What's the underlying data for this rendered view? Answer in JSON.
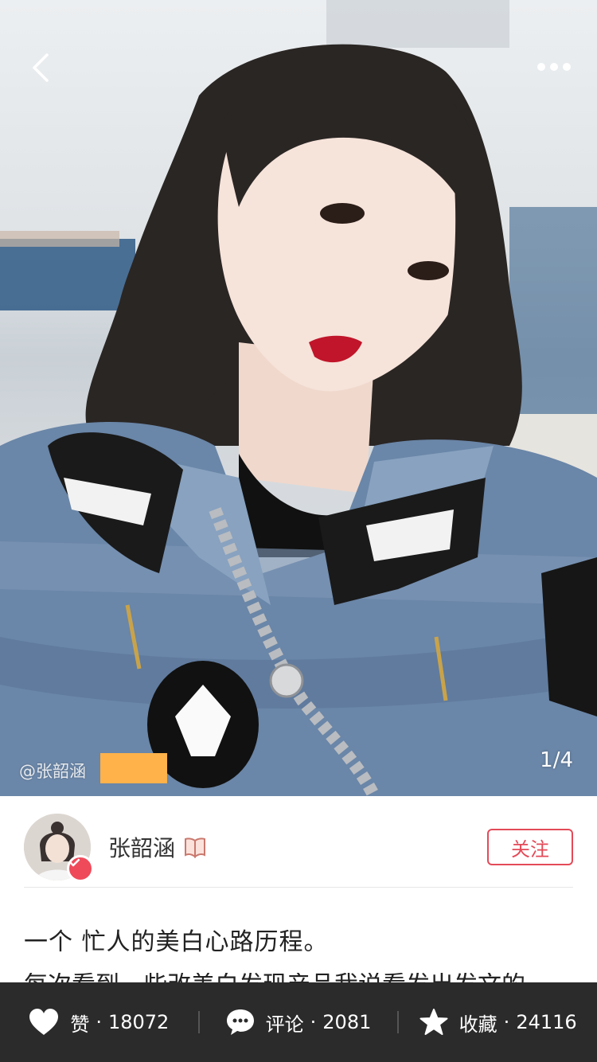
{
  "photo": {
    "watermark": "@张韶涵",
    "counter": "1/4"
  },
  "nav": {
    "back_icon": "chevron-left-icon",
    "more_icon": "more-dots-icon"
  },
  "author": {
    "name": "张韶涵",
    "badge_icon": "book-icon",
    "verified_icon": "check-icon",
    "follow_label": "关注"
  },
  "post": {
    "title": "一个 忙人的美白心路历程。",
    "body_partial": "每次看到一些改美白发现产品我说看发出发文的"
  },
  "actions": {
    "like": {
      "label": "赞",
      "dot": "·",
      "count": "18072",
      "icon": "heart-icon"
    },
    "comment": {
      "label": "评论",
      "dot": "·",
      "count": "2081",
      "icon": "chat-bubble-icon"
    },
    "collect": {
      "label": "收藏",
      "dot": "·",
      "count": "24116",
      "icon": "star-icon"
    }
  },
  "colors": {
    "accent": "#e44a58",
    "bottom_bar": "#2b2b2b"
  }
}
